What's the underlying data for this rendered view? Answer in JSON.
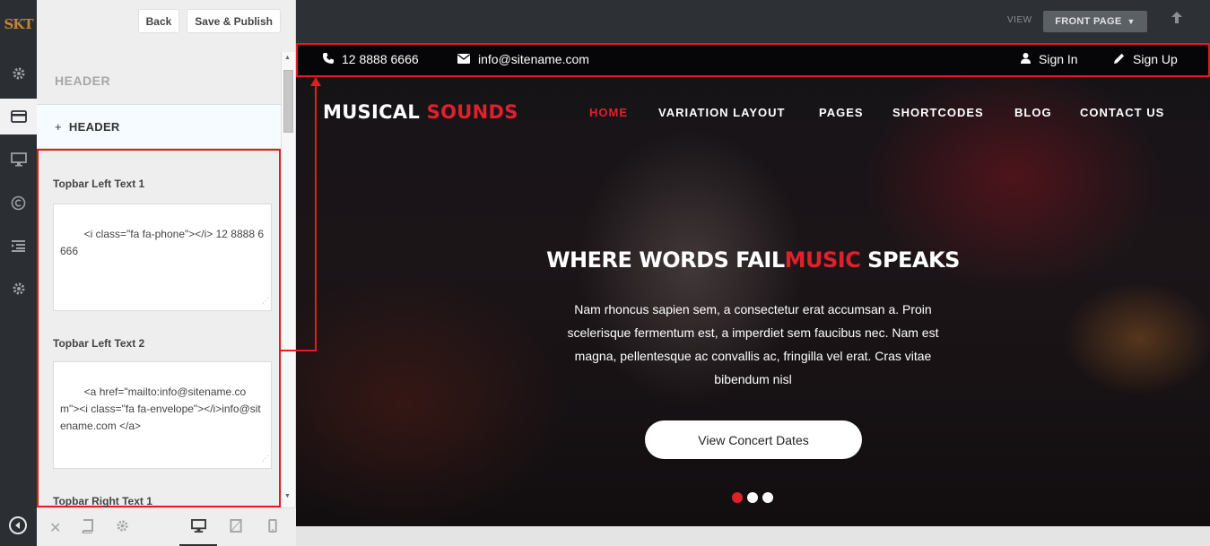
{
  "rail": {
    "logo": "SKT"
  },
  "panel": {
    "back_label": "Back",
    "publish_label": "Save & Publish",
    "section_title": "HEADER",
    "subsection": {
      "plus": "+",
      "label": "HEADER"
    },
    "fields": [
      {
        "label": "Topbar Left Text 1",
        "value": "<i class=\"fa fa-phone\"></i> 12 8888 6666"
      },
      {
        "label": "Topbar Left Text 2",
        "value": "<a href=\"mailto:info@sitename.com\"><i class=\"fa fa-envelope\"></i>info@sitename.com </a>"
      },
      {
        "label": "Topbar Right Text 1"
      }
    ]
  },
  "preview": {
    "view_label": "VIEW",
    "page_select": "FRONT PAGE",
    "topbar": {
      "phone": "12 8888 6666",
      "email": "info@sitename.com",
      "signin": "Sign In",
      "signup": "Sign Up"
    },
    "brand": {
      "part1": "MUSICAL",
      "part2": "SOUNDS"
    },
    "nav": [
      "HOME",
      "VARIATION LAYOUT",
      "PAGES",
      "SHORTCODES",
      "BLOG",
      "CONTACT US"
    ],
    "nav_active": "HOME",
    "hero": {
      "title_a": "WHERE WORDS FAIL",
      "title_b": "MUSIC",
      "title_c": " SPEAKS",
      "text": "Nam rhoncus sapien sem, a consectetur erat accumsan a. Proin scelerisque fermentum est, a imperdiet sem faucibus nec. Nam est magna, pellentesque ac convallis ac, fringilla vel erat. Cras vitae bibendum nisl",
      "cta": "View Concert Dates"
    },
    "slider": {
      "count": 3,
      "active": 1
    }
  },
  "colors": {
    "accent": "#e0202e",
    "highlight": "#e11d1d",
    "rail_bg": "#2b2f34",
    "logo": "#c9832a"
  }
}
